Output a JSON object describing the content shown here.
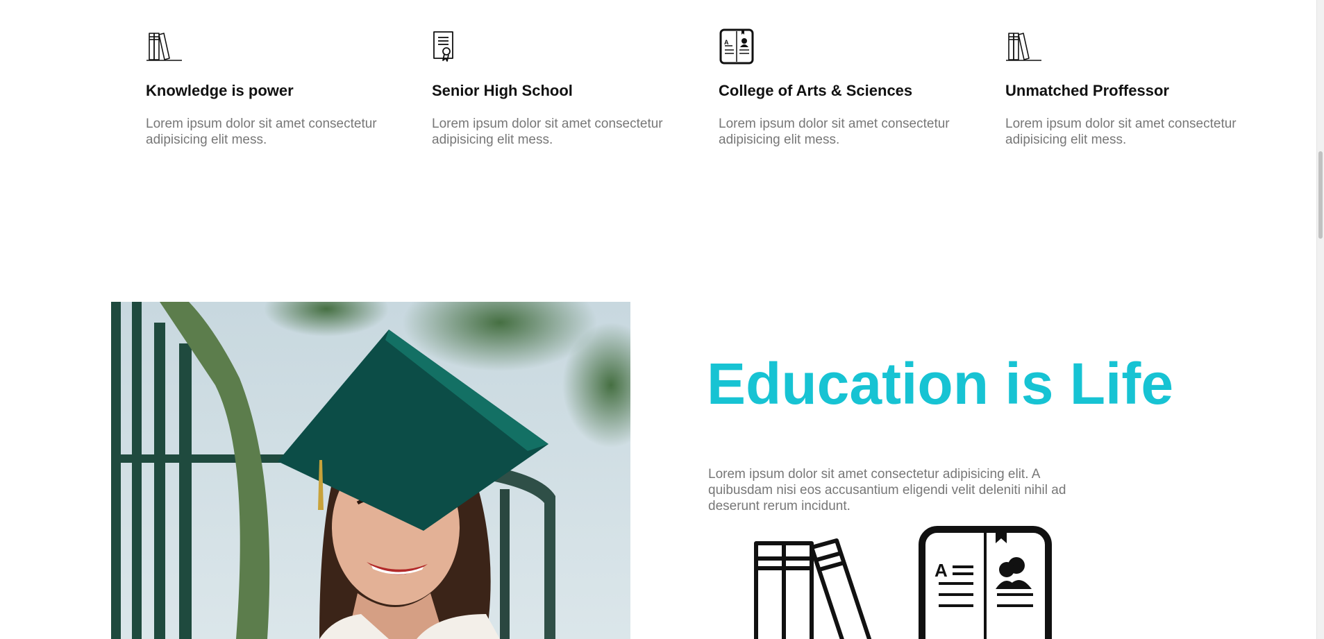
{
  "features": [
    {
      "icon": "books-icon",
      "title": "Knowledge is power",
      "text": "Lorem ipsum dolor sit amet consectetur adipisicing elit mess."
    },
    {
      "icon": "certificate-icon",
      "title": "Senior High School",
      "text": "Lorem ipsum dolor sit amet consectetur adipisicing elit mess."
    },
    {
      "icon": "open-book-icon",
      "title": "College of Arts & Sciences",
      "text": "Lorem ipsum dolor sit amet consectetur adipisicing elit mess."
    },
    {
      "icon": "books-icon",
      "title": "Unmatched Proffessor",
      "text": "Lorem ipsum dolor sit amet consectetur adipisicing elit mess."
    }
  ],
  "education": {
    "title": "Education is Life",
    "text": "Lorem ipsum dolor sit amet consectetur adipisicing elit. A quibusdam nisi eos accusantium eligendi velit deleniti nihil ad deserunt rerum incidunt.",
    "icons": [
      "books-icon",
      "open-book-icon"
    ]
  },
  "photo": {
    "subject": "graduate-photo"
  },
  "colors": {
    "accent": "#17c3d3",
    "heading": "#111111",
    "body_text": "#777777",
    "cap": "#0f5f57"
  }
}
